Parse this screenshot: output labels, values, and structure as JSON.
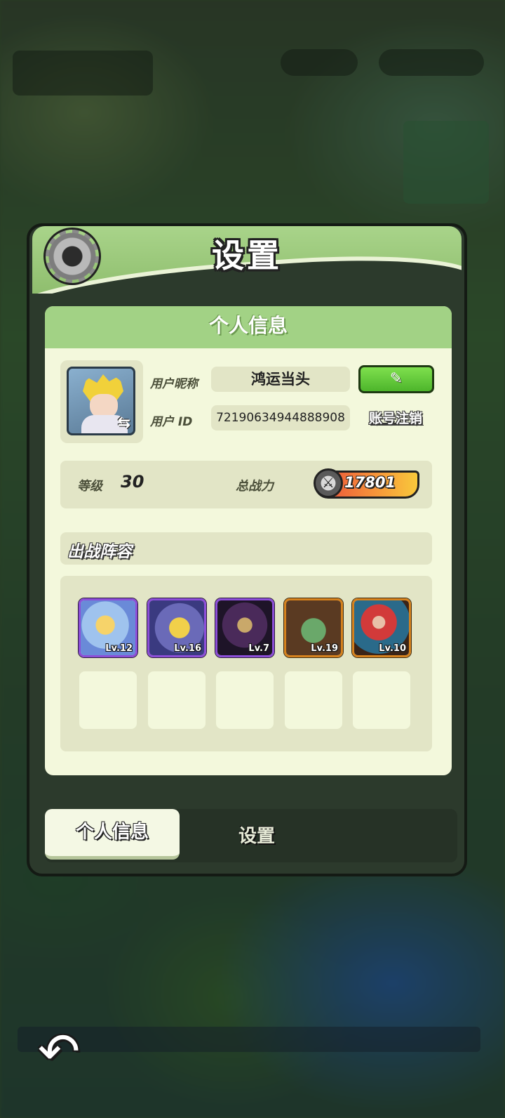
{
  "panel": {
    "title": "设置"
  },
  "profile": {
    "section_title": "个人信息",
    "nickname_label": "用户昵称",
    "nickname": "鸿运当头",
    "user_id_label": "用户 ID",
    "user_id": "72190634944888908",
    "edit_icon": "pencil-icon",
    "cancel_account": "账号注销"
  },
  "stats": {
    "level_label": "等级",
    "level": "30",
    "power_label": "总战力",
    "power": "17801"
  },
  "lineup": {
    "title": "出战阵容",
    "heroes": [
      {
        "level": "Lv.12",
        "rarity": "purple"
      },
      {
        "level": "Lv.16",
        "rarity": "purple"
      },
      {
        "level": "Lv.7",
        "rarity": "purple"
      },
      {
        "level": "Lv.19",
        "rarity": "orange"
      },
      {
        "level": "Lv.10",
        "rarity": "orange"
      }
    ],
    "empty_slots": 5
  },
  "tabs": [
    {
      "label": "个人信息",
      "active": true
    },
    {
      "label": "设置",
      "active": false
    }
  ],
  "colors": {
    "header_green": "#a2d285",
    "content_bg": "#f3f8dc",
    "purple_frame": "#8c4ed8",
    "orange_frame": "#d6821e",
    "edit_button": "#4db52b"
  }
}
